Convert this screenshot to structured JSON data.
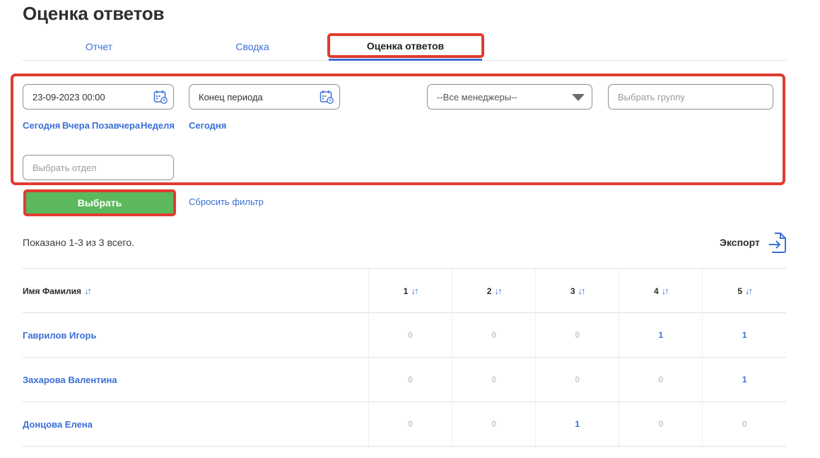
{
  "page": {
    "title": "Оценка ответов"
  },
  "tabs": [
    {
      "label": "Отчет",
      "active": false
    },
    {
      "label": "Сводка",
      "active": false
    },
    {
      "label": "Оценка ответов",
      "active": true
    }
  ],
  "filters": {
    "start_date": {
      "value": "23-09-2023 00:00"
    },
    "end_date": {
      "placeholder": "Конец периода"
    },
    "start_quick": [
      "Сегодня",
      "Вчера",
      "Позавчера",
      "Неделя"
    ],
    "end_quick": [
      "Сегодня"
    ],
    "manager_select": {
      "value": "--Все менеджеры--"
    },
    "group": {
      "placeholder": "Выбрать группу"
    },
    "department": {
      "placeholder": "Выбрать отдел"
    }
  },
  "actions": {
    "select_label": "Выбрать",
    "reset_label": "Сбросить фильтр"
  },
  "summary": {
    "text": "Показано 1-3 из 3 всего."
  },
  "export": {
    "label": "Экспорт"
  },
  "table": {
    "headers": [
      "Имя Фамилия",
      "1",
      "2",
      "3",
      "4",
      "5"
    ],
    "rows": [
      {
        "name": "Гаврилов Игорь",
        "values": [
          "0",
          "0",
          "0",
          "1",
          "1"
        ]
      },
      {
        "name": "Захарова Валентина",
        "values": [
          "0",
          "0",
          "0",
          "0",
          "1"
        ]
      },
      {
        "name": "Донцова Елена",
        "values": [
          "0",
          "0",
          "1",
          "0",
          "0"
        ]
      }
    ]
  },
  "colors": {
    "accent": "#3a6fd8",
    "highlight": "#e03c31",
    "button": "#5cb85c"
  },
  "icons": {
    "calendar": "calendar-icon",
    "export": "export-icon",
    "sort": "sort-icon",
    "dropdown": "chevron-down-icon"
  }
}
